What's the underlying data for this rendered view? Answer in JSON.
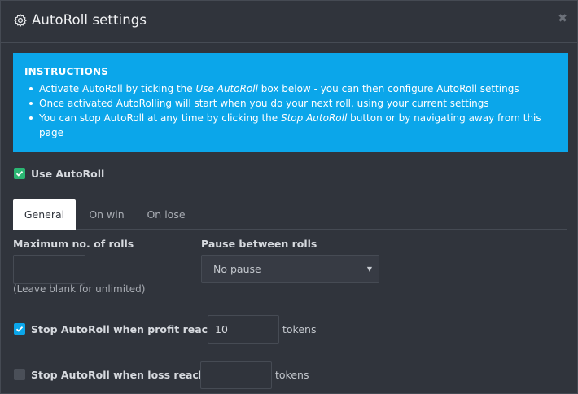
{
  "window": {
    "title": "AutoRoll settings",
    "close_label": "✖"
  },
  "instructions": {
    "title": "INSTRUCTIONS",
    "items": [
      {
        "before": "Activate AutoRoll by ticking the ",
        "emph": "Use AutoRoll",
        "after": " box below - you can then configure AutoRoll settings"
      },
      {
        "before": "Once activated AutoRolling will start when you do your next roll, using your current settings",
        "emph": "",
        "after": ""
      },
      {
        "before": "You can stop AutoRoll at any time by clicking the ",
        "emph": "Stop AutoRoll",
        "after": " button or by navigating away from this page"
      }
    ]
  },
  "use_autoroll": {
    "label": "Use AutoRoll",
    "checked": true,
    "color": "#2bb673"
  },
  "tabs": [
    {
      "label": "General",
      "active": true
    },
    {
      "label": "On win",
      "active": false
    },
    {
      "label": "On lose",
      "active": false
    }
  ],
  "general": {
    "max_rolls": {
      "label": "Maximum no. of rolls",
      "value": "",
      "hint": "(Leave blank for unlimited)"
    },
    "pause": {
      "label": "Pause between rolls",
      "selected": "No pause",
      "caret": "▼"
    },
    "stop_profit": {
      "label": "Stop AutoRoll when profit reaches",
      "checked": true,
      "value": "10",
      "unit": "tokens"
    },
    "stop_loss": {
      "label": "Stop AutoRoll when loss reaches",
      "checked": false,
      "value": "",
      "unit": "tokens"
    }
  },
  "colors": {
    "accent": "#0ba6ea",
    "background": "#30343c"
  }
}
